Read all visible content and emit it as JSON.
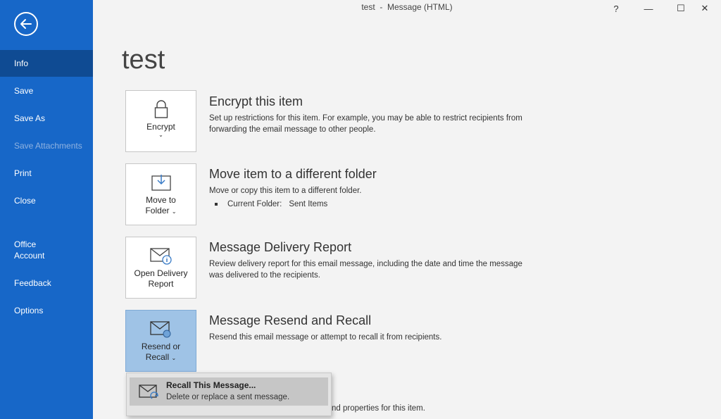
{
  "window": {
    "title": "test  -  Message (HTML)",
    "help_label": "?",
    "minimize_label": "—",
    "maximize_label": "☐",
    "close_label": "✕"
  },
  "sidebar": {
    "items": [
      {
        "label": "Info"
      },
      {
        "label": "Save"
      },
      {
        "label": "Save As"
      },
      {
        "label": "Save Attachments"
      },
      {
        "label": "Print"
      },
      {
        "label": "Close"
      },
      {
        "label": "Office\nAccount"
      },
      {
        "label": "Feedback"
      },
      {
        "label": "Options"
      }
    ]
  },
  "page": {
    "title": "test"
  },
  "sections": {
    "encrypt": {
      "button_label": "Encrypt",
      "heading": "Encrypt this item",
      "description": "Set up restrictions for this item. For example, you may be able to restrict recipients from forwarding the email message to other people."
    },
    "move": {
      "button_label_line1": "Move to",
      "button_label_line2": "Folder",
      "heading": "Move item to a different folder",
      "description": "Move or copy this item to a different folder.",
      "current_folder_label": "Current Folder:",
      "current_folder_value": "Sent Items"
    },
    "delivery": {
      "button_label_line1": "Open Delivery",
      "button_label_line2": "Report",
      "heading": "Message Delivery Report",
      "description": "Review delivery report for this email message, including the date and time the message was delivered to the recipients."
    },
    "resend": {
      "button_label_line1": "Resend or",
      "button_label_line2": "Recall",
      "heading": "Message Resend and Recall",
      "description": "Resend this email message or attempt to recall it from recipients."
    }
  },
  "dropdown": {
    "item_title": "Recall This Message...",
    "item_description": "Delete or replace a sent message."
  },
  "partial_text": "nd properties for this item.",
  "colors": {
    "sidebar_bg": "#1767c8",
    "sidebar_selected": "#0f4b93",
    "pressed_button": "#9fc3e6"
  }
}
